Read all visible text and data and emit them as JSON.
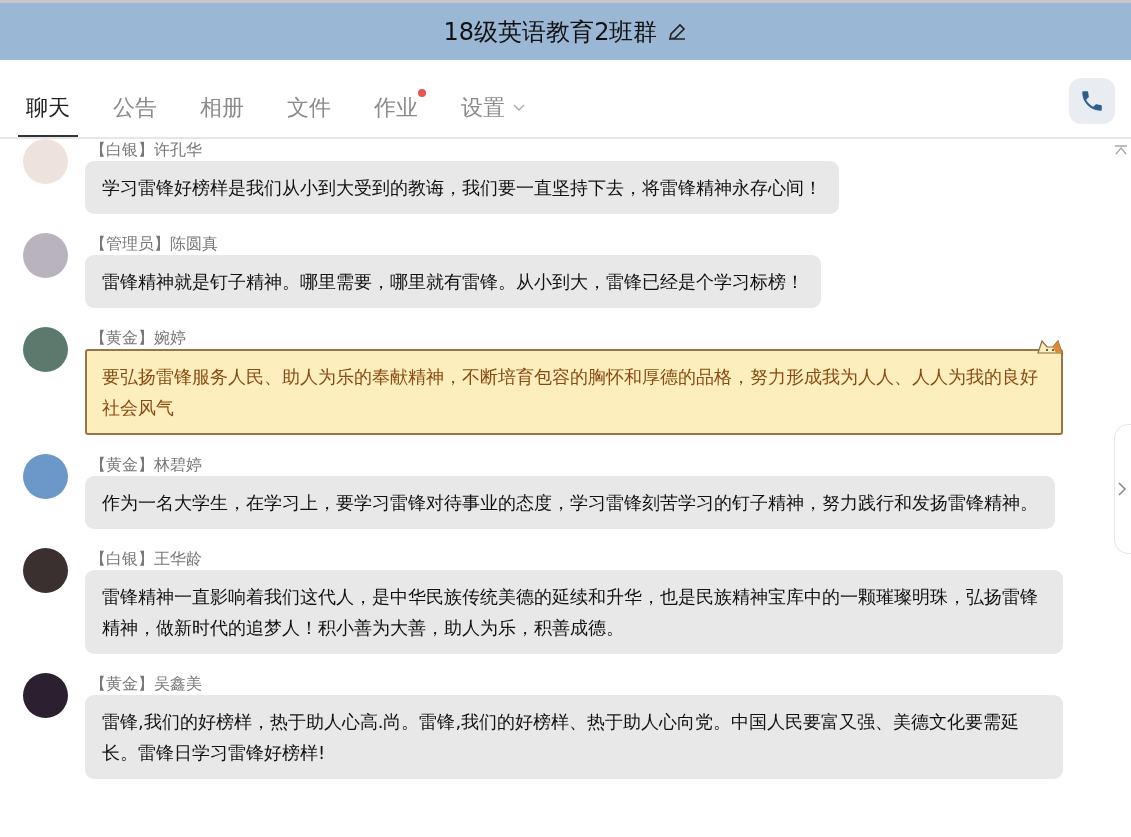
{
  "window": {
    "title": "18级英语教育2班群"
  },
  "tabs": [
    {
      "label": "聊天",
      "selected": true,
      "badge": false,
      "dropdown": false
    },
    {
      "label": "公告",
      "selected": false,
      "badge": false,
      "dropdown": false
    },
    {
      "label": "相册",
      "selected": false,
      "badge": false,
      "dropdown": false
    },
    {
      "label": "文件",
      "selected": false,
      "badge": false,
      "dropdown": false
    },
    {
      "label": "作业",
      "selected": false,
      "badge": true,
      "dropdown": false
    },
    {
      "label": "设置",
      "selected": false,
      "badge": false,
      "dropdown": true
    }
  ],
  "messages": [
    {
      "rank": "【白银】",
      "name": "许孔华",
      "kind": "plain",
      "text": "学习雷锋好榜样是我们从小到大受到的教诲，我们要一直坚持下去，将雷锋精神永存心间！"
    },
    {
      "rank": "【管理员】",
      "name": "陈圆真",
      "kind": "plain",
      "text": "雷锋精神就是钉子精神。哪里需要，哪里就有雷锋。从小到大，雷锋已经是个学习标榜！"
    },
    {
      "rank": "【黄金】",
      "name": "婉婷",
      "kind": "decorated",
      "text": "要弘扬雷锋服务人民、助人为乐的奉献精神，不断培育包容的胸怀和厚德的品格，努力形成我为人人、人人为我的良好社会风气"
    },
    {
      "rank": "【黄金】",
      "name": "林碧婷",
      "kind": "plain",
      "text": "作为一名大学生，在学习上，要学习雷锋对待事业的态度，学习雷锋刻苦学习的钉子精神，努力践行和发扬雷锋精神。"
    },
    {
      "rank": "【白银】",
      "name": "王华龄",
      "kind": "plain",
      "text": "雷锋精神一直影响着我们这代人，是中华民族传统美德的延续和升华，也是民族精神宝库中的一颗璀璨明珠，弘扬雷锋精神，做新时代的追梦人！积小善为大善，助人为乐，积善成德。"
    },
    {
      "rank": "【黄金】",
      "name": "吴鑫美",
      "kind": "plain",
      "text": "雷锋,我们的好榜样，热于助人心高.尚。雷锋,我们的好榜样、热于助人心向党。中国人民要富又强、美德文化要需延长。雷锋日学习雷锋好榜样!"
    }
  ]
}
